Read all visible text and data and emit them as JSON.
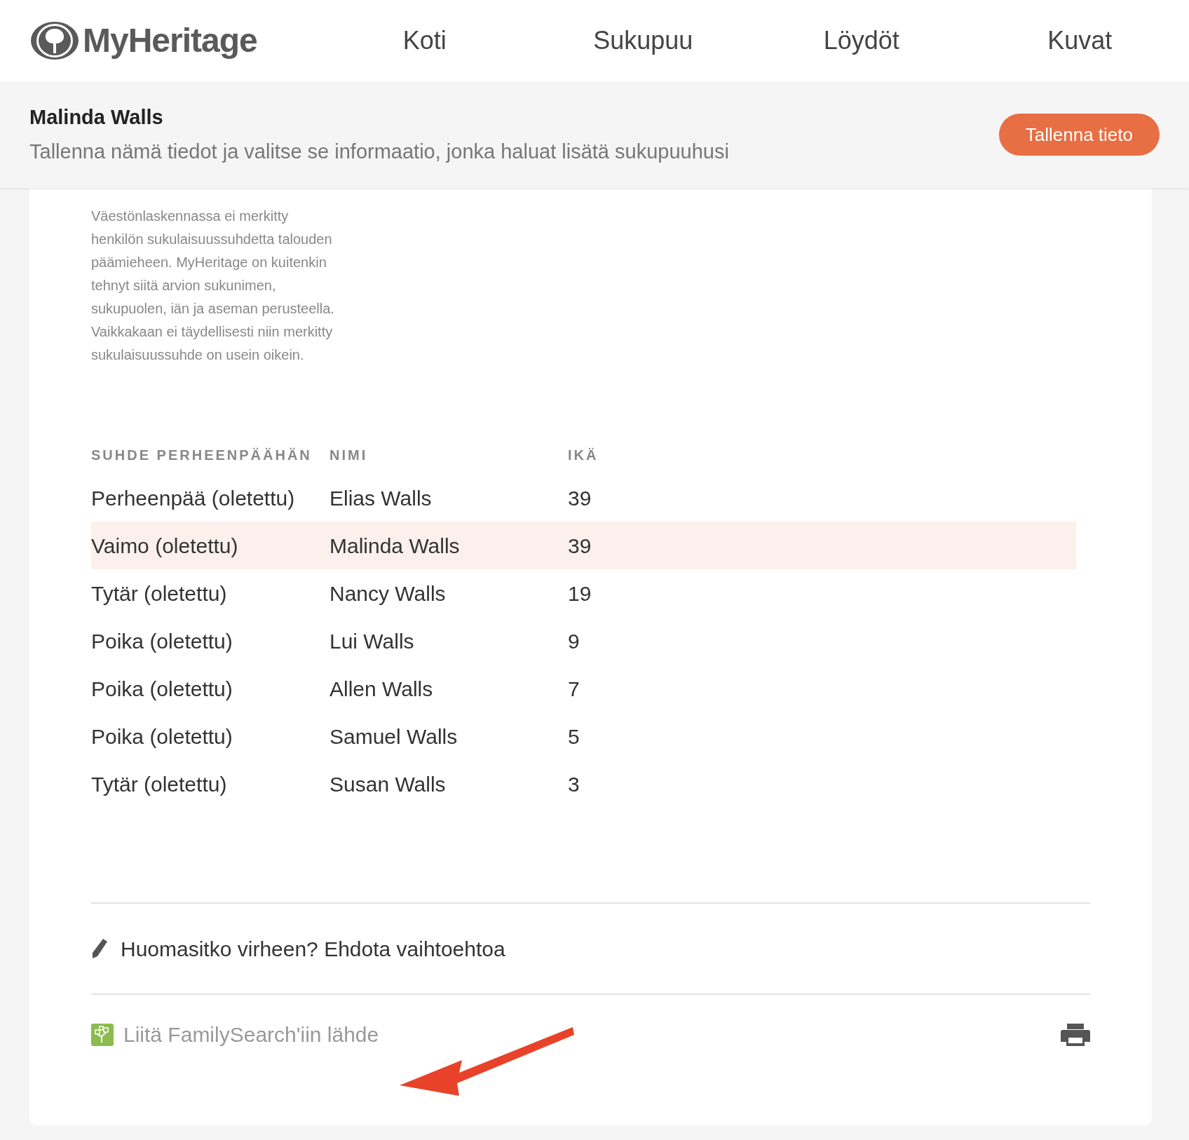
{
  "header": {
    "logo": "MyHeritage",
    "nav": [
      {
        "label": "Koti"
      },
      {
        "label": "Sukupuu"
      },
      {
        "label": "Löydöt"
      },
      {
        "label": "Kuvat"
      }
    ]
  },
  "record_bar": {
    "name": "Malinda Walls",
    "subtitle": "Tallenna nämä tiedot ja valitse se informaatio, jonka haluat lisätä sukupuuhusi",
    "save_button": "Tallenna tieto"
  },
  "note": "Väestönlaskennassa ei merkitty henkilön sukulaisuussuhdetta talouden päämieheen. MyHeritage on kuitenkin tehnyt siitä arvion sukunimen, sukupuolen, iän ja aseman perusteella. Vaikkakaan ei täydellisesti niin merkitty sukulaisuussuhde on usein oikein.",
  "table": {
    "columns": [
      "SUHDE PERHEENPÄÄHÄN",
      "NIMI",
      "IKÄ"
    ],
    "rows": [
      {
        "cells": [
          "Perheenpää (oletettu)",
          "Elias Walls",
          "39"
        ],
        "selected": false
      },
      {
        "cells": [
          "Vaimo (oletettu)",
          "Malinda Walls",
          "39"
        ],
        "selected": true
      },
      {
        "cells": [
          "Tytär (oletettu)",
          "Nancy Walls",
          "19"
        ],
        "selected": false
      },
      {
        "cells": [
          "Poika (oletettu)",
          "Lui Walls",
          "9"
        ],
        "selected": false
      },
      {
        "cells": [
          "Poika (oletettu)",
          "Allen Walls",
          "7"
        ],
        "selected": false
      },
      {
        "cells": [
          "Poika (oletettu)",
          "Samuel Walls",
          "5"
        ],
        "selected": false
      },
      {
        "cells": [
          "Tytär (oletettu)",
          "Susan Walls",
          "3"
        ],
        "selected": false
      }
    ]
  },
  "suggest_link": "Huomasitko virheen? Ehdota vaihtoehtoa",
  "familysearch_link": "Liitä FamilySearch'iin lähde"
}
